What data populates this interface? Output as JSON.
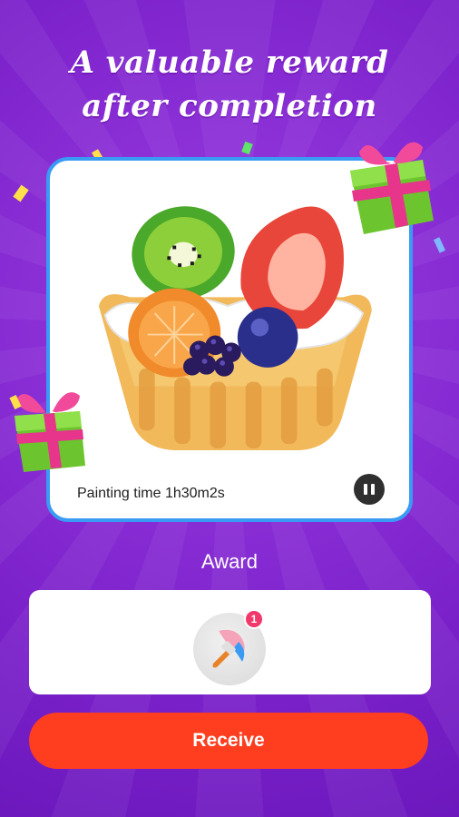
{
  "headline": {
    "line1": "A valuable reward",
    "line2": "after completion"
  },
  "artwork": {
    "subject": "fruit-tart-pixel-art"
  },
  "card": {
    "painting_time": "Painting time 1h30m2s"
  },
  "award": {
    "label": "Award",
    "item_icon": "paint-brush-icon",
    "badge_count": "1"
  },
  "actions": {
    "receive_label": "Receive"
  },
  "colors": {
    "background": "#8a2ed6",
    "card_border": "#3a9bf5",
    "button": "#ff3d1f",
    "badge": "#f2376a"
  }
}
